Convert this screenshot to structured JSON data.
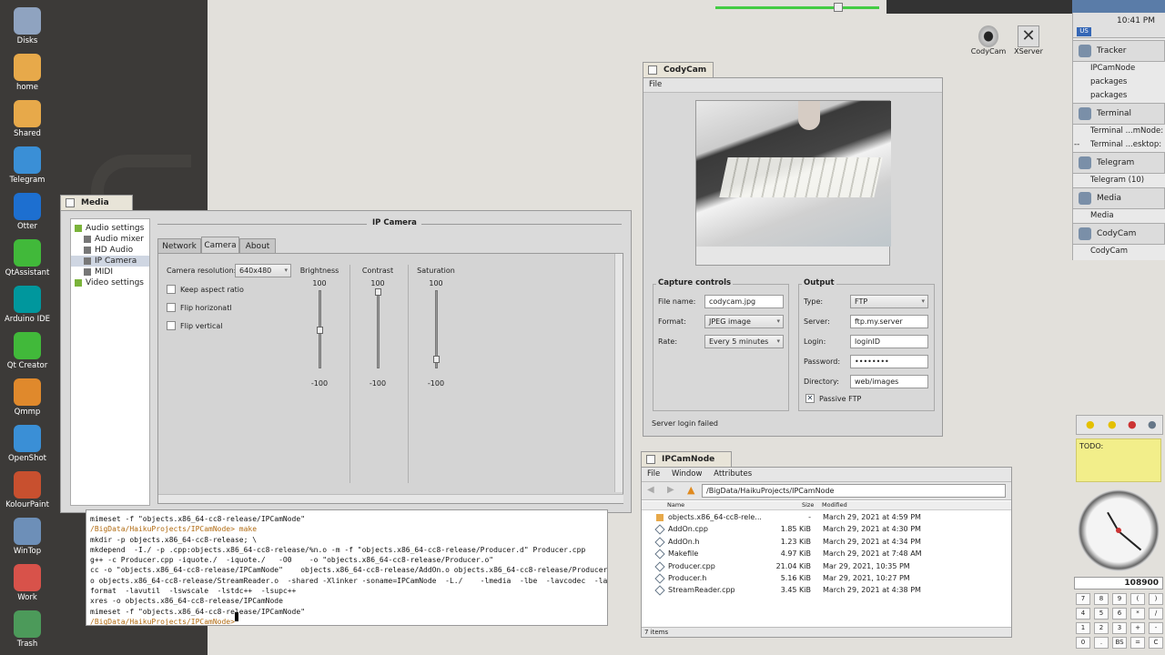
{
  "desktop_icons": [
    {
      "label": "Disks",
      "icon": "disk-icon",
      "color": "#8fa3c0"
    },
    {
      "label": "home",
      "icon": "home-folder-icon",
      "color": "#e7a94a"
    },
    {
      "label": "Shared",
      "icon": "shared-folder-icon",
      "color": "#e7a94a"
    },
    {
      "label": "Telegram",
      "icon": "telegram-icon",
      "color": "#3a8fd6"
    },
    {
      "label": "Otter",
      "icon": "otter-icon",
      "color": "#1d6fd0"
    },
    {
      "label": "QtAssistant",
      "icon": "qtassistant-icon",
      "color": "#41b93a"
    },
    {
      "label": "Arduino IDE",
      "icon": "arduino-icon",
      "color": "#00979d"
    },
    {
      "label": "Qt Creator",
      "icon": "qtcreator-icon",
      "color": "#41b93a"
    },
    {
      "label": "Qmmp",
      "icon": "qmmp-icon",
      "color": "#e0892c"
    },
    {
      "label": "OpenShot",
      "icon": "openshot-icon",
      "color": "#3a8fd6"
    },
    {
      "label": "KolourPaint",
      "icon": "kolourpaint-icon",
      "color": "#c8502f"
    },
    {
      "label": "WinTop",
      "icon": "wintop-icon",
      "color": "#6d8fb8"
    },
    {
      "label": "Work",
      "icon": "work-icon",
      "color": "#d8524a"
    },
    {
      "label": "Trash",
      "icon": "trash-icon",
      "color": "#4c9a5a"
    }
  ],
  "desktop_right_icons": [
    {
      "label": "CodyCam",
      "icon": "webcam-icon"
    },
    {
      "label": "XServer",
      "icon": "xserver-icon"
    }
  ],
  "deskbar": {
    "time": "10:41 PM",
    "keymap": "US",
    "apps": [
      {
        "name": "Tracker",
        "icon": "tracker-icon",
        "windows": [
          "IPCamNode",
          "packages",
          "packages"
        ]
      },
      {
        "name": "Terminal",
        "icon": "terminal-icon",
        "windows": [
          "Terminal ...mNode: --",
          "Terminal ...esktop: --"
        ]
      },
      {
        "name": "Telegram",
        "icon": "telegram-icon",
        "windows": [
          "Telegram (10)"
        ]
      },
      {
        "name": "Media",
        "icon": "media-icon",
        "windows": [
          "Media"
        ]
      },
      {
        "name": "CodyCam",
        "icon": "webcam-icon",
        "windows": [
          "CodyCam"
        ]
      }
    ]
  },
  "sticky_note": {
    "text": "TODO:",
    "color": "#f2ee8a"
  },
  "calculator": {
    "display": "108900",
    "keys": [
      [
        "7",
        "8",
        "9",
        "(",
        ")"
      ],
      [
        "4",
        "5",
        "6",
        "*",
        "/"
      ],
      [
        "1",
        "2",
        "3",
        "+",
        "-"
      ],
      [
        "0",
        ".",
        "BS",
        "=",
        "C"
      ]
    ]
  },
  "media_window": {
    "title": "Media",
    "sidebar": [
      {
        "label": "Audio settings",
        "level": 0,
        "icon": "audio-settings-icon"
      },
      {
        "label": "Audio mixer",
        "level": 1,
        "icon": "audio-mixer-icon"
      },
      {
        "label": "HD Audio",
        "level": 1,
        "icon": "hd-audio-icon"
      },
      {
        "label": "IP Camera",
        "level": 1,
        "icon": "ip-camera-icon",
        "selected": true
      },
      {
        "label": "MIDI",
        "level": 1,
        "icon": "midi-icon"
      },
      {
        "label": "Video settings",
        "level": 0,
        "icon": "video-settings-icon"
      }
    ],
    "panel_title": "IP Camera",
    "tabs": [
      "Network",
      "Camera",
      "About"
    ],
    "active_tab": "Camera",
    "resolution_label": "Camera resolution:",
    "resolution_value": "640x480",
    "checkboxes": [
      "Keep aspect ratio",
      "Flip horizonatl",
      "Flip vertical"
    ],
    "sliders": [
      {
        "label": "Brightness",
        "max": "100",
        "min": "-100",
        "value": 0
      },
      {
        "label": "Contrast",
        "max": "100",
        "min": "-100",
        "value": 100
      },
      {
        "label": "Saturation",
        "max": "100",
        "min": "-100",
        "value": -75
      }
    ]
  },
  "terminal": {
    "lines": [
      "mimeset -f \"objects.x86_64-cc8-release/IPCamNode\"",
      "/BigData/HaikuProjects/IPCamNode> make",
      "mkdir -p objects.x86_64-cc8-release; \\",
      "mkdepend  -I./ -p .cpp:objects.x86_64-cc8-release/%n.o -m -f \"objects.x86_64-cc8-release/Producer.d\" Producer.cpp",
      "g++ -c Producer.cpp -iquote./  -iquote./   -O0    -o \"objects.x86_64-cc8-release/Producer.o\"",
      "cc -o \"objects.x86_64-cc8-release/IPCamNode\"    objects.x86_64-cc8-release/AddOn.o objects.x86_64-cc8-release/Producer.",
      "o objects.x86_64-cc8-release/StreamReader.o  -shared -Xlinker -soname=IPCamNode  -L./    -lmedia  -lbe  -lavcodec  -lav",
      "format  -lavutil  -lswscale  -lstdc++  -lsupc++",
      "xres -o objects.x86_64-cc8-release/IPCamNode",
      "mimeset -f \"objects.x86_64-cc8-release/IPCamNode\"",
      "/BigData/HaikuProjects/IPCamNode> "
    ]
  },
  "codycam": {
    "title": "CodyCam",
    "menu": [
      "File"
    ],
    "capture": {
      "title": "Capture controls",
      "file_name_label": "File name:",
      "file_name": "codycam.jpg",
      "format_label": "Format:",
      "format": "JPEG image",
      "rate_label": "Rate:",
      "rate": "Every 5 minutes"
    },
    "output": {
      "title": "Output",
      "type_label": "Type:",
      "type": "FTP",
      "server_label": "Server:",
      "server": "ftp.my.server",
      "login_label": "Login:",
      "login": "loginID",
      "password_label": "Password:",
      "password": "••••••••",
      "directory_label": "Directory:",
      "directory": "web/images",
      "passive_label": "Passive FTP"
    },
    "status": "Server login failed"
  },
  "tracker": {
    "title": "IPCamNode",
    "menu": [
      "File",
      "Window",
      "Attributes"
    ],
    "path": "/BigData/HaikuProjects/IPCamNode",
    "columns": [
      "Name",
      "Size",
      "Modified"
    ],
    "files": [
      {
        "name": "objects.x86_64-cc8-rele...",
        "size": "-",
        "modified": "March 29, 2021 at 4:59 PM",
        "icon": "folder-icon"
      },
      {
        "name": "AddOn.cpp",
        "size": "1.85 KiB",
        "modified": "March 29, 2021 at 4:30 PM",
        "icon": "source-file-icon"
      },
      {
        "name": "AddOn.h",
        "size": "1.23 KiB",
        "modified": "March 29, 2021 at 4:34 PM",
        "icon": "source-file-icon"
      },
      {
        "name": "Makefile",
        "size": "4.97 KiB",
        "modified": "March 29, 2021 at 7:48 AM",
        "icon": "makefile-icon"
      },
      {
        "name": "Producer.cpp",
        "size": "21.04 KiB",
        "modified": "Mar 29, 2021, 10:35 PM",
        "icon": "source-file-icon"
      },
      {
        "name": "Producer.h",
        "size": "5.16 KiB",
        "modified": "Mar 29, 2021, 10:27 PM",
        "icon": "source-file-icon"
      },
      {
        "name": "StreamReader.cpp",
        "size": "3.45 KiB",
        "modified": "March 29, 2021 at 4:38 PM",
        "icon": "source-file-icon"
      }
    ],
    "count": "7 items"
  }
}
